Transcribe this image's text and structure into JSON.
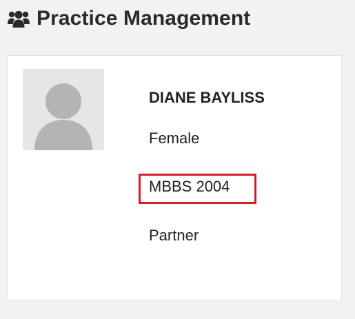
{
  "header": {
    "icon": "users-icon",
    "title": "Practice Management"
  },
  "profile": {
    "avatar_icon": "default-avatar-icon",
    "name": "DIANE BAYLISS",
    "gender": "Female",
    "qualification": "MBBS 2004",
    "role": "Partner"
  },
  "colors": {
    "background": "#f1f2f4",
    "card": "#ffffff",
    "highlight": "#d21f26",
    "avatar_bg": "#e6e6e6",
    "avatar_fg": "#b4b4b4"
  }
}
